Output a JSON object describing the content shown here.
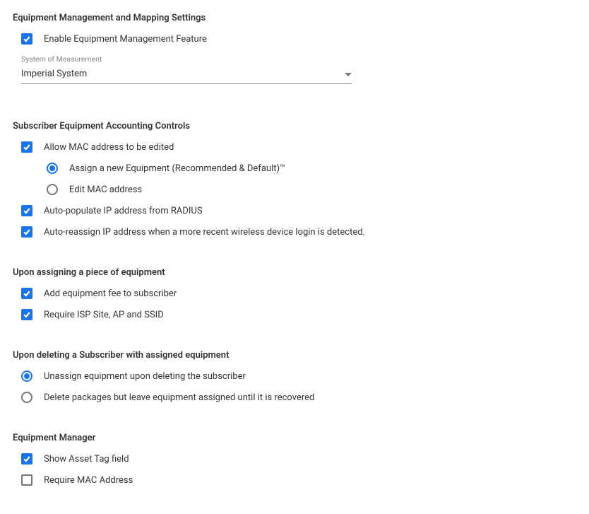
{
  "sections": {
    "mapping": {
      "title": "Equipment Management and Mapping Settings",
      "enable_label": "Enable Equipment Management Feature",
      "measure_label": "System of Measurement",
      "measure_value": "Imperial System"
    },
    "accounting": {
      "title": "Subscriber Equipment Accounting Controls",
      "allow_mac_edit": "Allow MAC address to be edited",
      "assign_new_equipment": "Assign a new Equipment (Recommended & Default)™",
      "edit_mac_address": "Edit MAC address",
      "auto_populate_ip": "Auto-populate IP address from RADIUS",
      "auto_reassign_ip": "Auto-reassign IP address when a more recent wireless device login is detected."
    },
    "upon_assign": {
      "title": "Upon assigning a piece of equipment",
      "add_fee": "Add equipment fee to subscriber",
      "require_isp": "Require ISP Site, AP and SSID"
    },
    "upon_delete": {
      "title": "Upon deleting a Subscriber with assigned equipment",
      "unassign": "Unassign equipment upon deleting the subscriber",
      "delete_packages": "Delete packages but leave equipment assigned until it is recovered"
    },
    "equip_manager": {
      "title": "Equipment Manager",
      "show_asset": "Show Asset Tag field",
      "require_mac": "Require MAC Address"
    }
  }
}
